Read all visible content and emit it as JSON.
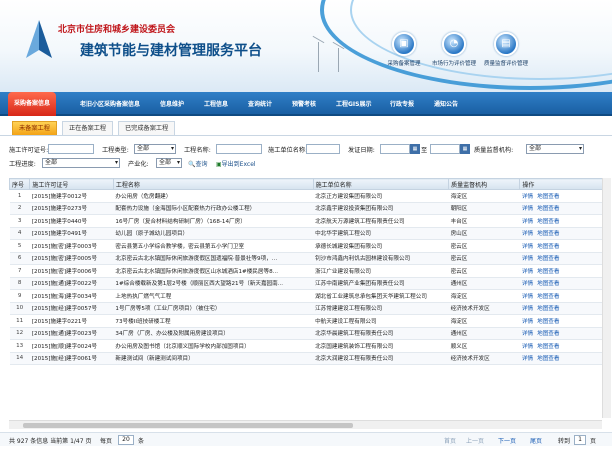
{
  "header": {
    "org": "北京市住房和城乡建设委员会",
    "system": "建筑节能与建材管理服务平台",
    "quick": [
      {
        "label": "采购备案管理",
        "icon": "cube-icon"
      },
      {
        "label": "市场行为评价管理",
        "icon": "chart-icon"
      },
      {
        "label": "质量监督评价管理",
        "icon": "clipboard-icon"
      }
    ]
  },
  "nav": [
    "采购备案信息",
    "老旧小区采购备案信息",
    "信息维护",
    "工程信息",
    "查询统计",
    "预警考核",
    "工程GIS展示",
    "行政专报",
    "通知公告"
  ],
  "subtabs": [
    "未备案工程",
    "正在备案工程",
    "已完成备案工程"
  ],
  "filters": {
    "permit_label": "施工许可证号:",
    "type_label": "工程类型:",
    "type_value": "全部",
    "name_label": "工程名称:",
    "unit_label": "施工单位名称:",
    "date_label": "发证日期:",
    "date_sep": "至",
    "dept_label": "质量监督机构:",
    "dept_value": "全部",
    "progress_label": "工程进度:",
    "progress_value": "全部",
    "industry_label": "产业化:",
    "industry_value": "全部",
    "search_btn": "查询",
    "export_btn": "导出到Excel"
  },
  "table": {
    "columns": [
      "序号",
      "施工许可证号",
      "工程名称",
      "施工单位名称",
      "质量监督机构",
      "操作"
    ],
    "rows": [
      [
        "1",
        "[2015]施建字0012号",
        "办公用房（危房翻建）",
        "北京正方建设集团有限公司",
        "海淀区"
      ],
      [
        "2",
        "[2015]施建字0273号",
        "配套热力设施（金海国际小区配套热力行政办公楼工程）",
        "北京鑫宇建设投资集团有限公司",
        "朝阳区"
      ],
      [
        "3",
        "[2015]施建字0440号",
        "16号厂房（复合材料结构研制厂房）（168-14厂房）",
        "北京航天万源建筑工程有限责任公司",
        "丰台区"
      ],
      [
        "4",
        "[2015]施建字0491号",
        "幼儿园（原子城幼儿园项目）",
        "中北华宇建筑工程公司",
        "房山区"
      ],
      [
        "5",
        "[2015]施[密]建字0003号",
        "密云县第五小学综合教学楼，密云县第五小学门卫室",
        "承德长城建设集团有限公司",
        "密云区"
      ],
      [
        "6",
        "[2015]施[密]建字0005号",
        "北京密云古北水镇国际休闲旅游度假区国遗福院·普景社等9项，...",
        "钊沙市鸿鑫内利饥古园林建设有限公司",
        "密云区"
      ],
      [
        "7",
        "[2015]施[密]建字0006号",
        "北京密云古北水镇国际休闲旅游度假区山水城酒店1#楼民居等8...",
        "浙江广业建设有限公司",
        "密云区"
      ],
      [
        "8",
        "[2015]施[通]建字0022号",
        "1#综合楼载新及第1层2号楼（顺丽区西大望路21号（新天嘉园南...",
        "江苏中南建筑产业集团有限责任公司",
        "通州区"
      ],
      [
        "9",
        "[2015]施[海]建字0034号",
        "上地热执厂燃气气工程",
        "湖北省工业建筑总承包集团天华建筑工程公司",
        "海淀区"
      ],
      [
        "10",
        "[2015]施[经]建字0057号",
        "1号厂房等5项（工业厂房项目）（被住宅）",
        "江苏常建建设工程有限公司",
        "经济技术开发区"
      ],
      [
        "11",
        "[2015]施建字0221号",
        "73号楼II班技研楼工程",
        "中航天建设工程有限公司",
        "海淀区"
      ],
      [
        "12",
        "[2015]施[通]建字0023号",
        "34厂房（厂房、办公楼及附属用房建设项目）",
        "北京华晨建筑工程有限责任公司",
        "通州区"
      ],
      [
        "13",
        "[2015]施[顺]建字0024号",
        "办公用房及图书馆（北京顺义国际学校内部加固项目）",
        "北京国建建筑装饰工程有限公司",
        "顺义区"
      ],
      [
        "14",
        "[2015]施[经]建字0061号",
        "新建测试间（新建测试间项目）",
        "北京大润建设工程有限责任公司",
        "经济技术开发区"
      ]
    ],
    "op_detail": "详情",
    "op_map": "地图查看"
  },
  "pager": {
    "summary": "共 927 条信息 当前第 1/47 页",
    "per_page_label": "每页",
    "per_page": "20",
    "per_page_unit": "条",
    "first": "首页",
    "prev": "上一页",
    "next": "下一页",
    "last": "尾页",
    "goto_label": "转到",
    "goto_value": "1",
    "goto_unit": "页"
  }
}
